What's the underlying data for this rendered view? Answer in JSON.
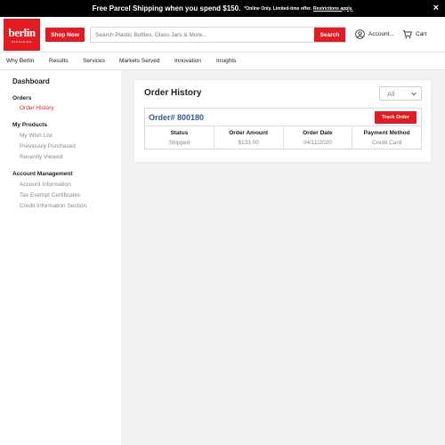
{
  "promo": {
    "main": "Free Parcel Shipping when you spend $150.",
    "fine": "*Online Only. Limited-time offer.",
    "link": "Restrictions apply.",
    "close": "×"
  },
  "header": {
    "logo_text": "berlin",
    "logo_sub": "PACKAGING",
    "shop_now": "Shop Now",
    "search_placeholder": "Search Plastic Bottles, Glass Jars & More...",
    "search_button": "Search",
    "account_label": "Account...",
    "cart_label": "Cart"
  },
  "nav": {
    "items": [
      "Why Berlin",
      "Results",
      "Services",
      "Markets Served",
      "Innovation",
      "Insights"
    ]
  },
  "sidebar": {
    "title": "Dashboard",
    "orders_header": "Orders",
    "order_history": "Order History",
    "products_header": "My Products",
    "wish_list": "My Wish List",
    "previously_purchased": "Previously Purchased",
    "recently_viewed": "Recently Viewed",
    "account_header": "Account Management",
    "account_information": "Account Information",
    "tax_exempt": "Tax Exempt Certificates",
    "credit_info": "Credit Information Section"
  },
  "main": {
    "title": "Order History",
    "filter_value": "All",
    "order": {
      "number": "Order# 800180",
      "track_button": "Track Order",
      "columns": [
        "Status",
        "Order Amount",
        "Order Date",
        "Payment Method"
      ],
      "values": [
        "Shipped",
        "$133.00",
        "04/11/2020",
        "Credit Card"
      ]
    }
  },
  "colors": {
    "brand_red": "#e31b23",
    "order_link_blue": "#2f5b9a",
    "content_bg": "#f1f1f1"
  },
  "icons": [
    "close-icon",
    "account-icon",
    "cart-icon",
    "chevron-down-icon"
  ]
}
